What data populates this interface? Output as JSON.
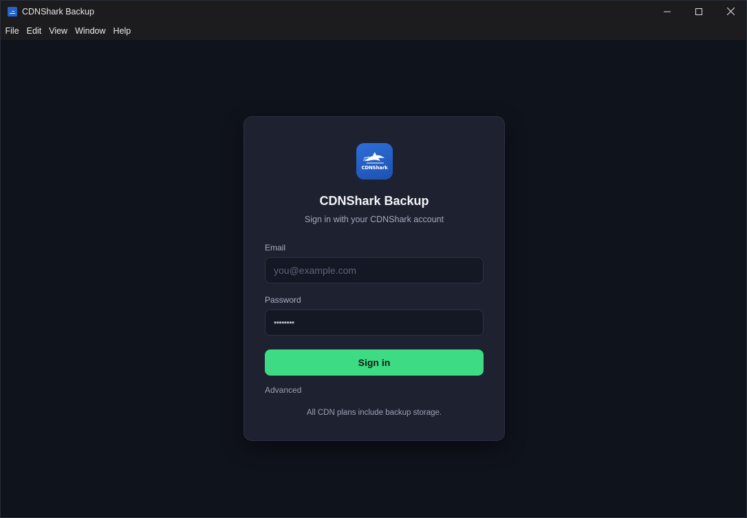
{
  "window": {
    "title": "CDNShark Backup",
    "controls": [
      "minimize-icon",
      "maximize-icon",
      "close-icon"
    ]
  },
  "menu": {
    "items": [
      "File",
      "Edit",
      "View",
      "Window",
      "Help"
    ]
  },
  "login": {
    "logo_text": "CDNShark",
    "title": "CDNShark Backup",
    "subtitle": "Sign in with your CDNShark account",
    "email_label": "Email",
    "email_placeholder": "you@example.com",
    "email_value": "",
    "password_label": "Password",
    "password_value": "••••••••",
    "signin_label": "Sign in",
    "advanced_label": "Advanced",
    "footer_note": "All CDN plans include backup storage."
  },
  "colors": {
    "accent": "#3ddc84",
    "brand": "#2563c9",
    "background": "#0f131c",
    "card": "#1e2130"
  }
}
